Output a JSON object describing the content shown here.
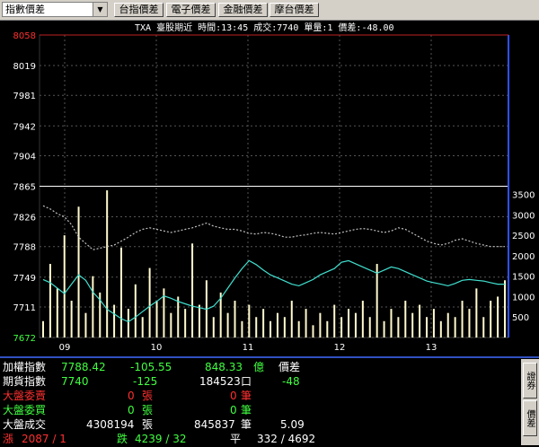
{
  "toolbar": {
    "selector": "指數價差",
    "buttons": [
      "台指價差",
      "電子價差",
      "金融價差",
      "摩台價差"
    ]
  },
  "info_line": "TXA  臺股期近 時間:13:45 成交:7740 單量:1  價差:-48.00",
  "chart_data": {
    "type": "line",
    "title": "",
    "left_axis_ticks": [
      "8058",
      "8019",
      "7981",
      "7942",
      "7904",
      "7865",
      "7826",
      "7788",
      "7749",
      "7711",
      "7672"
    ],
    "right_axis_ticks": [
      "3500",
      "3000",
      "2500",
      "2000",
      "1500",
      "1000",
      "500"
    ],
    "x_labels": [
      "09",
      "10",
      "11",
      "12",
      "13"
    ],
    "ylim": [
      7672,
      8058
    ],
    "volume_ylim": [
      0,
      3700
    ],
    "reference_level": 7865,
    "series": [
      {
        "values": [
          7746,
          7742,
          7735,
          7728,
          7740,
          7752,
          7745,
          7730,
          7720,
          7708,
          7702,
          7696,
          7692,
          7698,
          7705,
          7712,
          7718,
          7725,
          7722,
          7718,
          7715,
          7712,
          7710,
          7708,
          7712,
          7722,
          7735,
          7748,
          7760,
          7770,
          7765,
          7758,
          7752,
          7748,
          7744,
          7740,
          7738,
          7742,
          7746,
          7752,
          7756,
          7760,
          7768,
          7770,
          7766,
          7762,
          7758,
          7754,
          7758,
          7762,
          7760,
          7756,
          7752,
          7748,
          7744,
          7742,
          7740,
          7738,
          7741,
          7745,
          7746,
          7745,
          7744,
          7742,
          7740,
          7740
        ]
      },
      {
        "values": [
          7840,
          7836,
          7830,
          7826,
          7816,
          7800,
          7792,
          7784,
          7786,
          7788,
          7790,
          7795,
          7800,
          7806,
          7810,
          7812,
          7810,
          7808,
          7806,
          7808,
          7810,
          7812,
          7815,
          7818,
          7814,
          7812,
          7810,
          7810,
          7808,
          7805,
          7804,
          7806,
          7805,
          7803,
          7800,
          7800,
          7802,
          7803,
          7805,
          7806,
          7805,
          7804,
          7806,
          7808,
          7810,
          7811,
          7810,
          7808,
          7806,
          7808,
          7812,
          7810,
          7805,
          7800,
          7795,
          7792,
          7790,
          7792,
          7796,
          7798,
          7795,
          7792,
          7790,
          7788,
          7788,
          7788
        ]
      },
      {
        "values": [
          400,
          1800,
          1200,
          2500,
          900,
          3200,
          600,
          1500,
          1100,
          3600,
          800,
          2200,
          700,
          1300,
          500,
          1700,
          900,
          1200,
          600,
          1000,
          700,
          2300,
          800,
          1400,
          500,
          1100,
          600,
          900,
          400,
          800,
          500,
          700,
          400,
          600,
          500,
          900,
          400,
          700,
          300,
          600,
          400,
          800,
          500,
          700,
          600,
          900,
          500,
          1800,
          400,
          700,
          500,
          900,
          600,
          800,
          500,
          700,
          400,
          600,
          500,
          900,
          700,
          1200,
          500,
          900,
          1000,
          1400
        ]
      }
    ]
  },
  "panel": {
    "r1": {
      "label": "加權指數",
      "value": "7788.42",
      "change": "-105.55",
      "amount": "848.33",
      "unit": "億",
      "tag": "價差"
    },
    "r2": {
      "label": "期貨指數",
      "value": "7740",
      "change": "-125",
      "amount": "184523",
      "unit": "口",
      "tag": "-48"
    },
    "r3": {
      "label": "大盤委賣",
      "zhang": "0",
      "zhang_unit": "張",
      "bi": "0",
      "bi_unit": "筆"
    },
    "r4": {
      "label": "大盤委買",
      "zhang": "0",
      "zhang_unit": "張",
      "bi": "0",
      "bi_unit": "筆"
    },
    "r5": {
      "label": "大盤成交",
      "zhang": "4308194",
      "zhang_unit": "張",
      "bi": "845837",
      "bi_unit": "筆",
      "ratio": "5.09"
    },
    "r6": {
      "up_label": "漲",
      "up": "2087 / 1",
      "down_label": "跌",
      "down": "4239 / 32",
      "flat_label": "平",
      "flat": "332 / 4692"
    }
  },
  "side_tabs": [
    "證券",
    "價差"
  ],
  "colors": {
    "up": "#ff3030",
    "down": "#40ff40",
    "price": "#ffffff",
    "index_line": "#40e0d0",
    "futures_line": "#c0c0c0",
    "volume": "#fffacd"
  }
}
